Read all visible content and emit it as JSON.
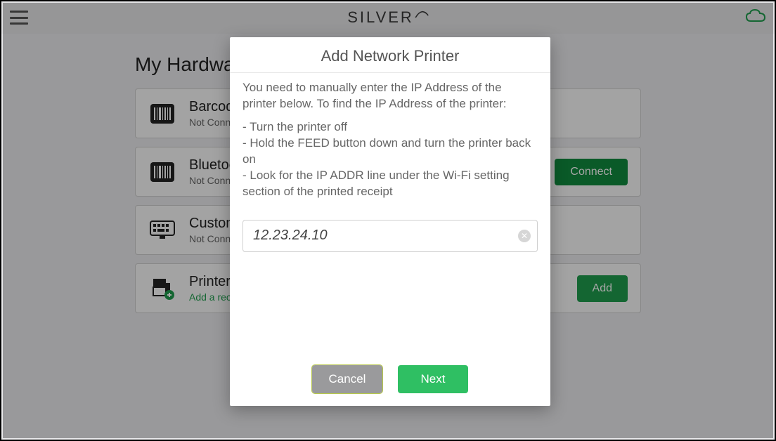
{
  "header": {
    "brand": "SILVER"
  },
  "page": {
    "title": "My Hardware"
  },
  "hardware": [
    {
      "title": "Barcode Scanner",
      "subtitle": "Not Connected",
      "button": null,
      "sub_green": false,
      "icon": "barcode"
    },
    {
      "title": "Bluetooth Printer",
      "subtitle": "Not Connected",
      "button": "Connect",
      "sub_green": false,
      "icon": "barcode"
    },
    {
      "title": "Customer Display",
      "subtitle": "Not Connected",
      "button": null,
      "sub_green": false,
      "icon": "keyboard"
    },
    {
      "title": "Printers",
      "subtitle": "Add a receipt printer",
      "button": "Add",
      "sub_green": true,
      "icon": "printer"
    }
  ],
  "modal": {
    "title": "Add Network Printer",
    "intro": "You need to manually enter the IP Address of the printer below. To find the IP Address of the printer:",
    "step1": "- Turn the printer off",
    "step2": "- Hold the FEED button down and turn the printer back on",
    "step3": "- Look for the IP ADDR line under the Wi-Fi setting section of the printed receipt",
    "ip_value": "12.23.24.10",
    "cancel": "Cancel",
    "next": "Next"
  }
}
